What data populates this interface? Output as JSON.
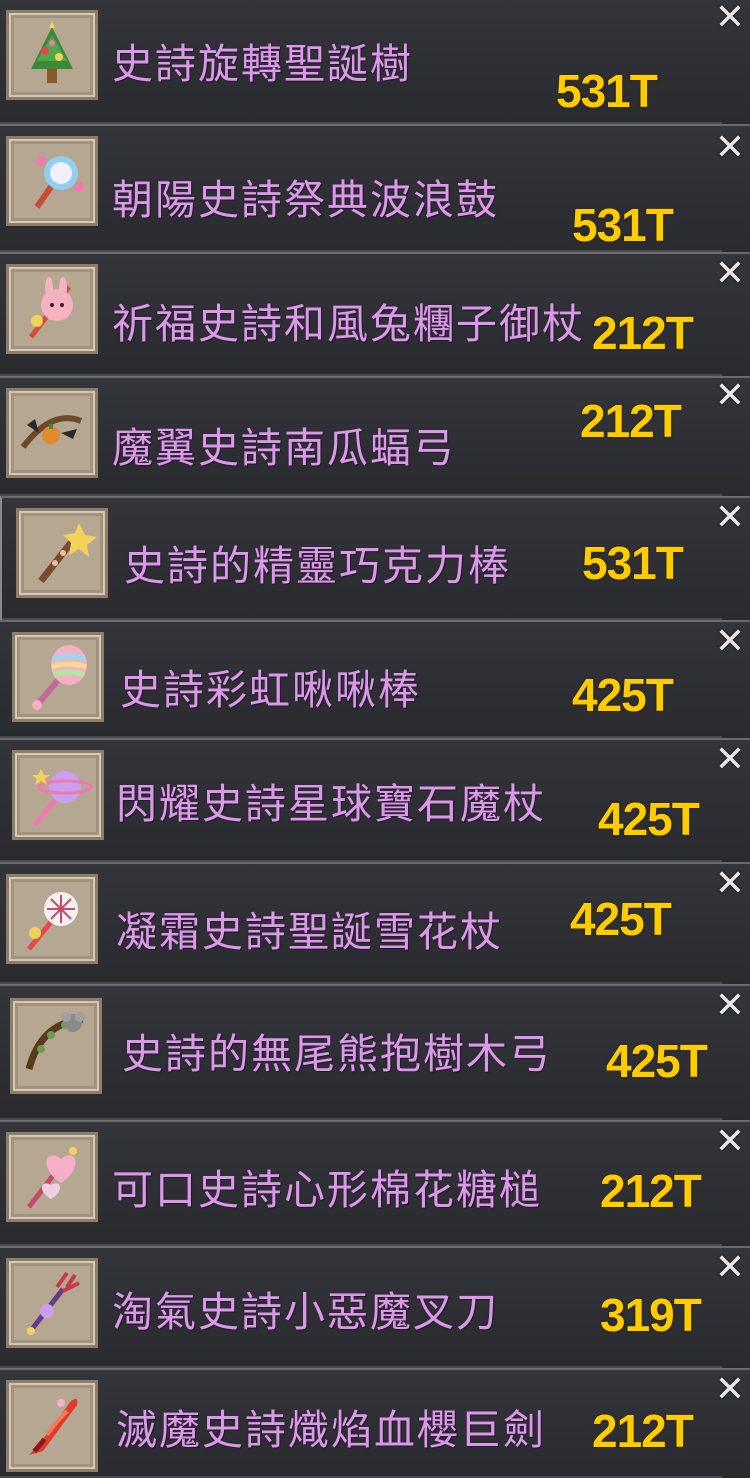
{
  "items": [
    {
      "name": "史詩旋轉聖誕樹",
      "price": "531T",
      "icon": "christmas-tree-icon",
      "colors": [
        "#3b8a3a",
        "#e34a4a",
        "#f2d35a"
      ]
    },
    {
      "name": "朝陽史詩祭典波浪鼓",
      "price": "531T",
      "icon": "drum-rattle-icon",
      "colors": [
        "#8fd0f0",
        "#f07ab0",
        "#c94a3a"
      ]
    },
    {
      "name": "祈福史詩和風兔糰子御杖",
      "price": "212T",
      "icon": "rabbit-dango-staff-icon",
      "colors": [
        "#f5b2c2",
        "#d84a3a",
        "#f2d35a"
      ]
    },
    {
      "name": "魔翼史詩南瓜蝠弓",
      "price": "212T",
      "icon": "pumpkin-bat-bow-icon",
      "colors": [
        "#2a2a2a",
        "#e08a2a",
        "#6a4a2a"
      ]
    },
    {
      "name": "史詩的精靈巧克力棒",
      "price": "531T",
      "icon": "fairy-chocolate-wand-icon",
      "colors": [
        "#7a4a2a",
        "#f2d35a",
        "#e8c0a0"
      ]
    },
    {
      "name": "史詩彩虹啾啾棒",
      "price": "425T",
      "icon": "rainbow-rattle-wand-icon",
      "colors": [
        "#f5b0c8",
        "#9ad8f0",
        "#f0e08a"
      ]
    },
    {
      "name": "閃耀史詩星球寶石魔杖",
      "price": "425T",
      "icon": "planet-gem-wand-icon",
      "colors": [
        "#c8a0f0",
        "#f07ab0",
        "#f2d35a"
      ]
    },
    {
      "name": "凝霜史詩聖誕雪花杖",
      "price": "425T",
      "icon": "snowflake-staff-icon",
      "colors": [
        "#f0f0f0",
        "#e34a4a",
        "#f2d35a"
      ]
    },
    {
      "name": "史詩的無尾熊抱樹木弓",
      "price": "425T",
      "icon": "koala-tree-bow-icon",
      "colors": [
        "#8a8a8a",
        "#5a3a1a",
        "#6aa04a"
      ]
    },
    {
      "name": "可口史詩心形棉花糖槌",
      "price": "212T",
      "icon": "heart-marshmallow-mallet-icon",
      "colors": [
        "#f5b0c8",
        "#f0d0e0",
        "#c84a6a"
      ]
    },
    {
      "name": "淘氣史詩小惡魔叉刀",
      "price": "319T",
      "icon": "imp-trident-icon",
      "colors": [
        "#c83a4a",
        "#6a3a8a",
        "#f2d35a"
      ]
    },
    {
      "name": "滅魔史詩熾焰血櫻巨劍",
      "price": "212T",
      "icon": "flame-blood-sakura-sword-icon",
      "colors": [
        "#e03a2a",
        "#f07a5a",
        "#8a1a1a"
      ]
    }
  ],
  "close_glyph": "✕",
  "accent": {
    "name_color": "#d89ae4",
    "price_color": "#ffcc00",
    "background": "#2b2c30"
  }
}
